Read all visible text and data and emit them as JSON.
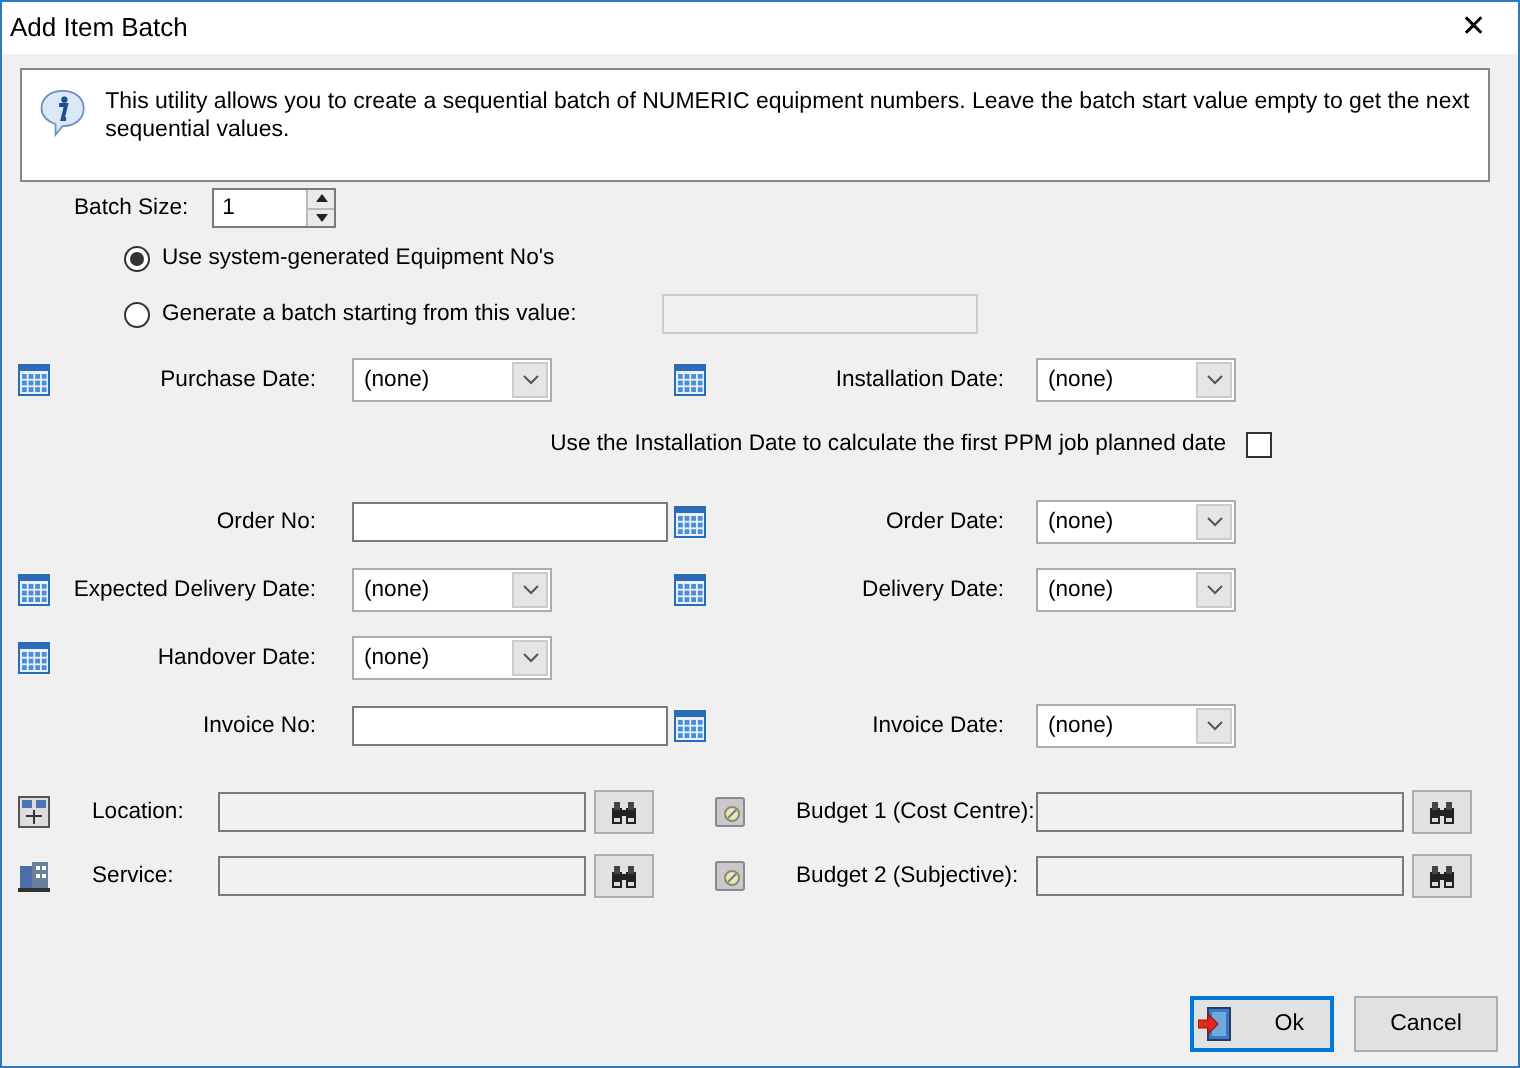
{
  "window": {
    "title": "Add Item Batch",
    "close": "✕"
  },
  "info": {
    "text": "This utility allows you to create a sequential batch of NUMERIC equipment numbers. Leave the batch start value empty to get the next sequential values."
  },
  "batch_size": {
    "label": "Batch Size:",
    "value": "1"
  },
  "numbering": [
    {
      "label": "Use system-generated Equipment No's",
      "selected": true,
      "kind": "plain"
    },
    {
      "label": "Generate a batch starting from this value:",
      "selected": false,
      "kind": "with-field"
    }
  ],
  "form_rows": [
    {
      "kind": "pair",
      "left": {
        "label": "Purchase Date:",
        "kind": "date",
        "value": "(none)"
      },
      "right": {
        "label": "Installation Date:",
        "kind": "date",
        "value": "(none)"
      }
    },
    {
      "kind": "check",
      "label": "Use the Installation Date to calculate the first PPM job planned date",
      "checked": false
    },
    {
      "kind": "pair",
      "left": {
        "label": "Order No:",
        "kind": "text"
      },
      "right": {
        "label": "Order Date:",
        "kind": "date",
        "value": "(none)"
      }
    },
    {
      "kind": "pair",
      "left": {
        "label": "Expected Delivery Date:",
        "kind": "date",
        "value": "(none)"
      },
      "right": {
        "label": "Delivery Date:",
        "kind": "date",
        "value": "(none)"
      }
    },
    {
      "kind": "pair",
      "left": {
        "label": "Handover Date:",
        "kind": "date",
        "value": "(none)"
      }
    },
    {
      "kind": "pair",
      "left": {
        "label": "Invoice No:",
        "kind": "text"
      },
      "right": {
        "label": "Invoice Date:",
        "kind": "date",
        "value": "(none)"
      }
    }
  ],
  "lookups": [
    {
      "left": {
        "label": "Location:",
        "kind": "location"
      },
      "right": {
        "label": "Budget 1 (Cost Centre):",
        "kind": "budget"
      }
    },
    {
      "left": {
        "label": "Service:",
        "kind": "service"
      },
      "right": {
        "label": "Budget 2 (Subjective):",
        "kind": "budget"
      }
    }
  ],
  "buttons": [
    {
      "label": "Ok",
      "default": true
    },
    {
      "label": "Cancel",
      "default": false
    }
  ]
}
